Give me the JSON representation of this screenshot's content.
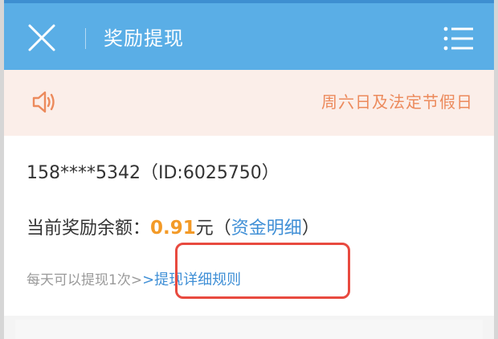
{
  "header": {
    "title": "奖励提现",
    "close_icon": "close-icon",
    "menu_icon": "menu-icon",
    "background_color": "#5aaee6"
  },
  "notice": {
    "icon": "speaker-icon",
    "text": "周六日及法定节假日",
    "text_color": "#ec8a5c",
    "background_color": "#fbeee9"
  },
  "account": {
    "phone": "158****5342",
    "id_text": "（ID:6025750）"
  },
  "balance": {
    "label": "当前奖励余额：",
    "amount": "0.91",
    "unit": "元",
    "paren_open": "（",
    "details_link": "资金明细",
    "paren_close": "）",
    "amount_color": "#f39a27"
  },
  "rule": {
    "text": "每天可以提现1次>",
    "link_prefix": ">",
    "link": "提现详细规则",
    "link_color": "#3f8fd6"
  },
  "highlight": {
    "color": "#e84a3f"
  }
}
